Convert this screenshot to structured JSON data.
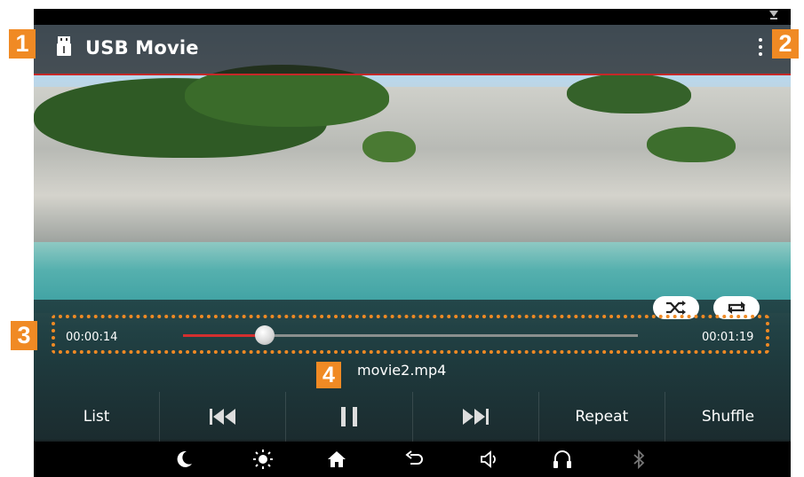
{
  "header": {
    "title": "USB Movie",
    "source_icon": "usb-icon",
    "menu_icon": "more-vert-icon"
  },
  "player": {
    "elapsed": "00:00:14",
    "duration": "00:01:19",
    "progress_fraction": 0.18,
    "filename": "movie2.mp4",
    "mode_buttons": [
      "shuffle-icon",
      "repeat-icon"
    ]
  },
  "controls": {
    "list_label": "List",
    "prev_icon": "skip-previous-icon",
    "pause_icon": "pause-icon",
    "next_icon": "skip-next-icon",
    "repeat_label": "Repeat",
    "shuffle_label": "Shuffle"
  },
  "navbar": {
    "icons": [
      "moon-icon",
      "brightness-icon",
      "home-icon",
      "back-icon",
      "volume-icon",
      "headphones-icon",
      "bluetooth-icon"
    ]
  },
  "callouts": {
    "c1": "1",
    "c2": "2",
    "c3": "3",
    "c4": "4"
  },
  "colors": {
    "accent": "#d32f2f",
    "callout": "#f08a24"
  }
}
